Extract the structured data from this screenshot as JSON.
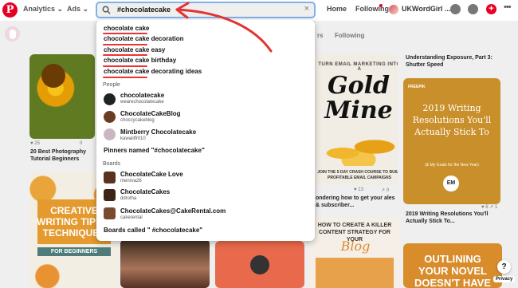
{
  "topbar": {
    "logo": "P",
    "analytics_label": "Analytics",
    "ads_label": "Ads",
    "search_value": "#chocolatecake",
    "home_label": "Home",
    "following_label": "Following",
    "username": "UKWordGirl ...",
    "plus": "+",
    "more": "•••"
  },
  "subtabs": {
    "following": "Following"
  },
  "dropdown": {
    "suggestions": [
      "chocolate cake",
      "chocolate cake decoration",
      "chocolate cake easy",
      "chocolate cake birthday",
      "chocolate cake decorating ideas"
    ],
    "people_label": "People",
    "people": [
      {
        "name": "chocolatecake",
        "handle": "wearechocolatecake"
      },
      {
        "name": "ChocolateCakeBlog",
        "handle": "choccycakeblog"
      },
      {
        "name": "Mintberry Chocolatecake",
        "handle": "kawaiitfrit10"
      }
    ],
    "pinners_named": "Pinners named \"#chocolatecake\"",
    "boards_label": "Boards",
    "boards": [
      {
        "name": "ChocolateCake Love",
        "handle": "menrva26"
      },
      {
        "name": "ChocolateCakes",
        "handle": "ddrotha"
      },
      {
        "name": "ChocolateCakes@CakeRental.com",
        "handle": "cakerental"
      }
    ],
    "boards_called": "Boards called \" #chocolatecake\""
  },
  "pins": {
    "sunflower": {
      "saves": "25",
      "caption": "20 Best Photography Tutorial Beginners",
      "stat2": "0"
    },
    "gold": {
      "title": "TURN EMAIL MARKETING INTO A",
      "big": "Gold Mine",
      "foot": "JOIN THE 5 DAY CRASH COURSE TO BUILD PROFITABLE EMAIL CAMPAIGNS",
      "stat1": "13",
      "stat2": "0",
      "caption": "ondering how to get your ales & subscriber..."
    },
    "exposure": {
      "caption": "Understanding Exposure, Part 3: Shutter Speed"
    },
    "resolution": {
      "tag": "FREEPIK",
      "text": "2019 Writing Resolutions You'll Actually Stick To",
      "sub": "(& My Goals for the New Year)",
      "badge": "EM",
      "stat1": "6",
      "stat2": "1",
      "caption": "2019 Writing Resolutions You'll Actually Stick To..."
    },
    "creative": {
      "text": "CREATIVE WRITING TIPS & TECHNIQUES",
      "foot": "FOR BEGINNERS"
    },
    "killer": {
      "text": "HOW TO CREATE A KILLER CONTENT STRATEGY FOR YOUR",
      "blog": "Blog"
    },
    "outline": {
      "text": "OUTLINING YOUR NOVEL DOESN'T HAVE TO SUCK"
    }
  },
  "help": "?",
  "privacy": "Privacy",
  "colors": {
    "brand": "#e60023",
    "annotation": "#e33333",
    "search_focus": "#7fb2ea"
  }
}
